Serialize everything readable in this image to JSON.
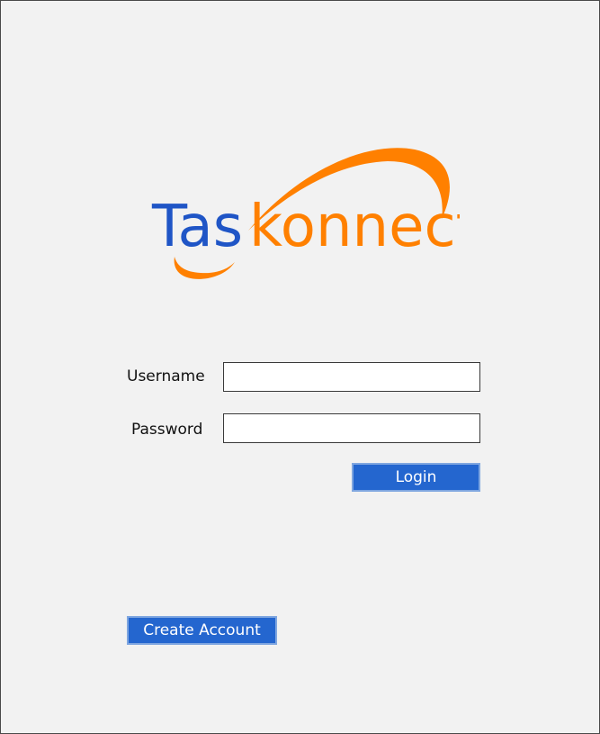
{
  "logo": {
    "part1": "Tas",
    "part2": "konnect",
    "primary_color": "#1f55c6",
    "accent_color": "#ff8000"
  },
  "form": {
    "username_label": "Username",
    "username_value": "",
    "password_label": "Password",
    "password_value": "",
    "login_label": "Login"
  },
  "footer": {
    "create_account_label": "Create Account"
  },
  "colors": {
    "background": "#f2f2f2",
    "button": "#2466cf",
    "button_border": "#7fa6e0"
  }
}
